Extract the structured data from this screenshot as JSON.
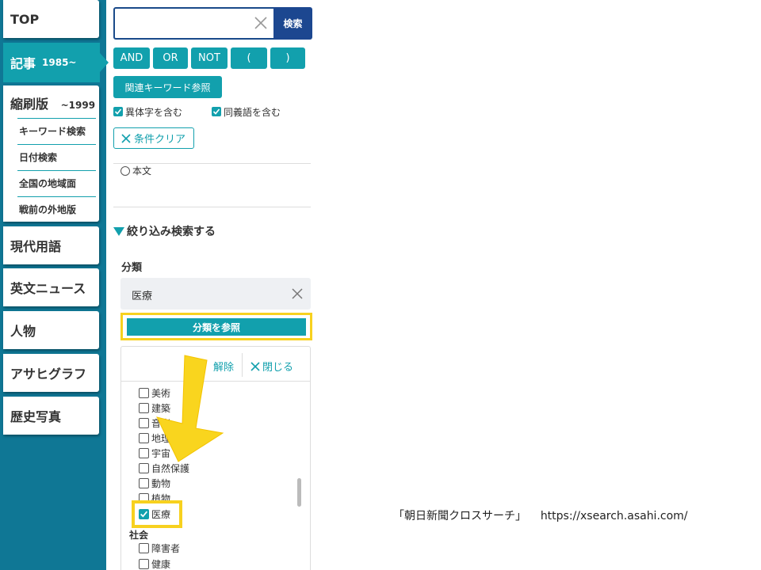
{
  "nav": {
    "top": "TOP",
    "kiji": {
      "label": "記事",
      "range": "1985~"
    },
    "shukusatsu": {
      "label": "縮刷版",
      "range": "~1999"
    },
    "sub_items": [
      "キーワード検索",
      "日付検索",
      "全国の地域面",
      "戦前の外地版"
    ],
    "gendai": "現代用語",
    "eibun": "英文ニュース",
    "jinbutsu": "人物",
    "asahigraph": "アサヒグラフ",
    "rekishi": "歴史写真"
  },
  "search": {
    "value": "",
    "placeholder": "",
    "button": "検索",
    "operators": [
      "AND",
      "OR",
      "NOT",
      "(",
      ")"
    ],
    "related_keywords": "関連キーワード参照",
    "variant_chars": "異体字を含む",
    "synonyms": "同義語を含む",
    "clear": "条件クリア",
    "body_text": "本文"
  },
  "refine": {
    "heading": "絞り込み検索する",
    "category_label": "分類",
    "category_value": "医療",
    "reference_button": "分類を参照",
    "release": "解除",
    "close": "閉じる",
    "options": [
      {
        "label": "美術",
        "checked": false
      },
      {
        "label": "建築",
        "checked": false
      },
      {
        "label": "音楽",
        "checked": false
      },
      {
        "label": "地理",
        "checked": false
      },
      {
        "label": "宇宙",
        "checked": false
      },
      {
        "label": "自然保護",
        "checked": false
      },
      {
        "label": "動物",
        "checked": false
      },
      {
        "label": "植物",
        "checked": false
      },
      {
        "label": "医療",
        "checked": true
      }
    ],
    "group_society": "社会",
    "society_options": [
      {
        "label": "障害者",
        "checked": false
      },
      {
        "label": "健康",
        "checked": false
      }
    ]
  },
  "caption": {
    "source": "「朝日新聞クロスサーチ」",
    "url": "https://xsearch.asahi.com/"
  },
  "colors": {
    "nav_bg": "#0f7795",
    "accent": "#12a0ad",
    "search_button": "#1c4790",
    "highlight": "#f7d11f"
  }
}
